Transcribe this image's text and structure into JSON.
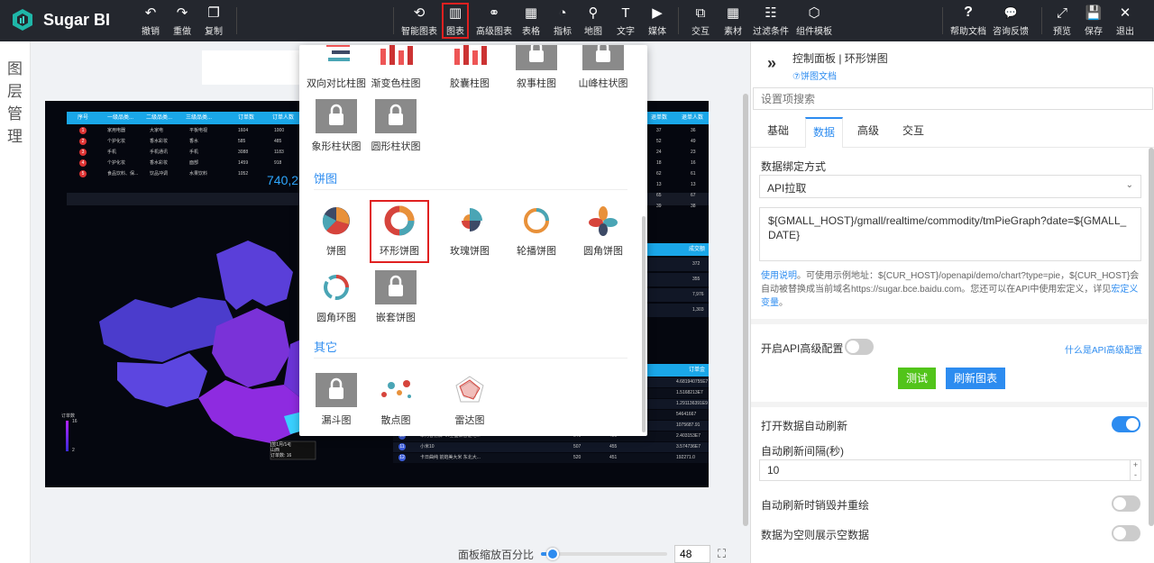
{
  "app": {
    "name": "Sugar BI"
  },
  "toolbar_left": [
    {
      "id": "undo",
      "label": "撤销",
      "icon": "undo-icon"
    },
    {
      "id": "redo",
      "label": "重做",
      "icon": "redo-icon"
    },
    {
      "id": "copy",
      "label": "复制",
      "icon": "copy-icon"
    }
  ],
  "toolbar_mid": [
    {
      "id": "smart",
      "label": "智能图表",
      "icon": "smart-chart-icon"
    },
    {
      "id": "chart",
      "label": "图表",
      "icon": "bar-chart-icon",
      "active": true
    },
    {
      "id": "adv",
      "label": "高级图表",
      "icon": "advanced-chart-icon"
    },
    {
      "id": "table",
      "label": "表格",
      "icon": "table-icon"
    },
    {
      "id": "indicator",
      "label": "指标",
      "icon": "gauge-icon"
    },
    {
      "id": "map",
      "label": "地图",
      "icon": "map-pin-icon"
    },
    {
      "id": "text",
      "label": "文字",
      "icon": "text-icon"
    },
    {
      "id": "media",
      "label": "媒体",
      "icon": "media-icon"
    },
    {
      "id": "interact",
      "label": "交互",
      "icon": "interaction-icon"
    },
    {
      "id": "material",
      "label": "素材",
      "icon": "material-icon"
    },
    {
      "id": "filter",
      "label": "过滤条件",
      "icon": "filter-icon"
    },
    {
      "id": "template",
      "label": "组件模板",
      "icon": "template-icon"
    }
  ],
  "toolbar_right": [
    {
      "id": "help",
      "label": "帮助文档",
      "icon": "question-icon"
    },
    {
      "id": "feedback",
      "label": "咨询反馈",
      "icon": "feedback-icon"
    },
    {
      "id": "preview",
      "label": "预览",
      "icon": "expand-icon"
    },
    {
      "id": "save",
      "label": "保存",
      "icon": "save-icon"
    },
    {
      "id": "exit",
      "label": "退出",
      "icon": "close-icon"
    }
  ],
  "left_panel": {
    "chars": [
      "图",
      "层",
      "管",
      "理"
    ]
  },
  "chart_menu": {
    "top_row": [
      "双向对比柱图",
      "渐变色柱图",
      "胶囊柱图",
      "叙事柱图",
      "山峰柱状图"
    ],
    "row2": [
      "象形柱状图",
      "圆形柱状图"
    ],
    "pie_section": "饼图",
    "pie_row1": [
      "饼图",
      "环形饼图",
      "玫瑰饼图",
      "轮播饼图",
      "圆角饼图"
    ],
    "pie_row2": [
      "圆角环图",
      "嵌套饼图"
    ],
    "other_section": "其它",
    "other_row": [
      "漏斗图",
      "散点图",
      "雷达图"
    ],
    "selected": "环形饼图"
  },
  "board": {
    "table1_headers": [
      "序号",
      "一级品类...",
      "二级品类...",
      "三级品类...",
      "订单数",
      "订单人数"
    ],
    "table1_rows": [
      [
        "1",
        "家用电器",
        "大家电",
        "平板电视",
        "1604",
        "1000"
      ],
      [
        "2",
        "个护化妆",
        "香水彩妆",
        "香水",
        "585",
        "485"
      ],
      [
        "3",
        "手机",
        "手机通讯",
        "手机",
        "3088",
        "1183"
      ],
      [
        "4",
        "个护化妆",
        "香水彩妆",
        "面部",
        "1459",
        "918"
      ],
      [
        "5",
        "食品饮料、保...",
        "饮品冲调",
        "水果饮料",
        "1052",
        ""
      ]
    ],
    "big_number": "740,25",
    "right_small_headers": [
      "退单数",
      "退单人数"
    ],
    "right_small_rows": [
      [
        "37",
        "36"
      ],
      [
        "52",
        "49"
      ],
      [
        "24",
        "23"
      ],
      [
        "18",
        "16"
      ],
      [
        "62",
        "61"
      ],
      [
        "13",
        "13"
      ],
      [
        "65",
        "67"
      ],
      [
        "39",
        "38"
      ]
    ],
    "mid_header": "成交额",
    "mid_values": [
      "372",
      "355",
      "7,976",
      "1,303"
    ],
    "bottom_header": "订单金额",
    "bottom_values": [
      "4.681940755E7",
      "1.5168213E7",
      "1.291136391E9",
      "54641667",
      "1075687.91",
      "2.403153E7",
      "3.574736E7",
      "192271.0"
    ],
    "bottom_rows": [
      [
        "10",
        "华为智慧屏 4K全面屏智能电...",
        "546",
        "480"
      ],
      [
        "11",
        "小米10",
        "507",
        "455"
      ],
      [
        "12",
        "卡日曲纯 前炮美大米 东北大...",
        "520",
        "451"
      ]
    ],
    "legend": {
      "top": "订单数",
      "max": "16",
      "min": "2"
    },
    "tooltip": [
      "[签1月/14]",
      "山西",
      "订单数: 16"
    ]
  },
  "zoom": {
    "label": "面板缩放百分比",
    "value": "48",
    "fraction": 0.48
  },
  "right_panel": {
    "title": "控制面板 | 环形饼图",
    "doc_link": "⑦饼图文档",
    "search_placeholder": "设置项搜索",
    "tabs": [
      "基础",
      "数据",
      "高级",
      "交互"
    ],
    "active_tab": "数据",
    "binding_label": "数据绑定方式",
    "binding_value": "API拉取",
    "api_url": "${GMALL_HOST}/gmall/realtime/commodity/tmPieGraph?date=${GMALL_DATE}",
    "help_prefix": "使用说明",
    "help_text": "。可使用示例地址：${CUR_HOST}/openapi/demo/chart?type=pie，${CUR_HOST}会自动被替换成当前域名https://sugar.bce.baidu.com。您还可以在API中使用宏定义，详见",
    "help_link": "宏定义变量",
    "help_end": "。",
    "api_adv_label": "开启API高级配置",
    "api_adv_link": "什么是API高级配置",
    "btn_test": "测试",
    "btn_refresh": "刷新图表",
    "auto_refresh_label": "打开数据自动刷新",
    "interval_label": "自动刷新间隔(秒)",
    "interval_value": "10",
    "destroy_label": "自动刷新时销毁并重绘",
    "empty_label": "数据为空则展示空数据",
    "colors": {
      "accent": "#2d8cf0",
      "test": "#52c41a",
      "toggle_on": "#2d8cf0"
    }
  }
}
